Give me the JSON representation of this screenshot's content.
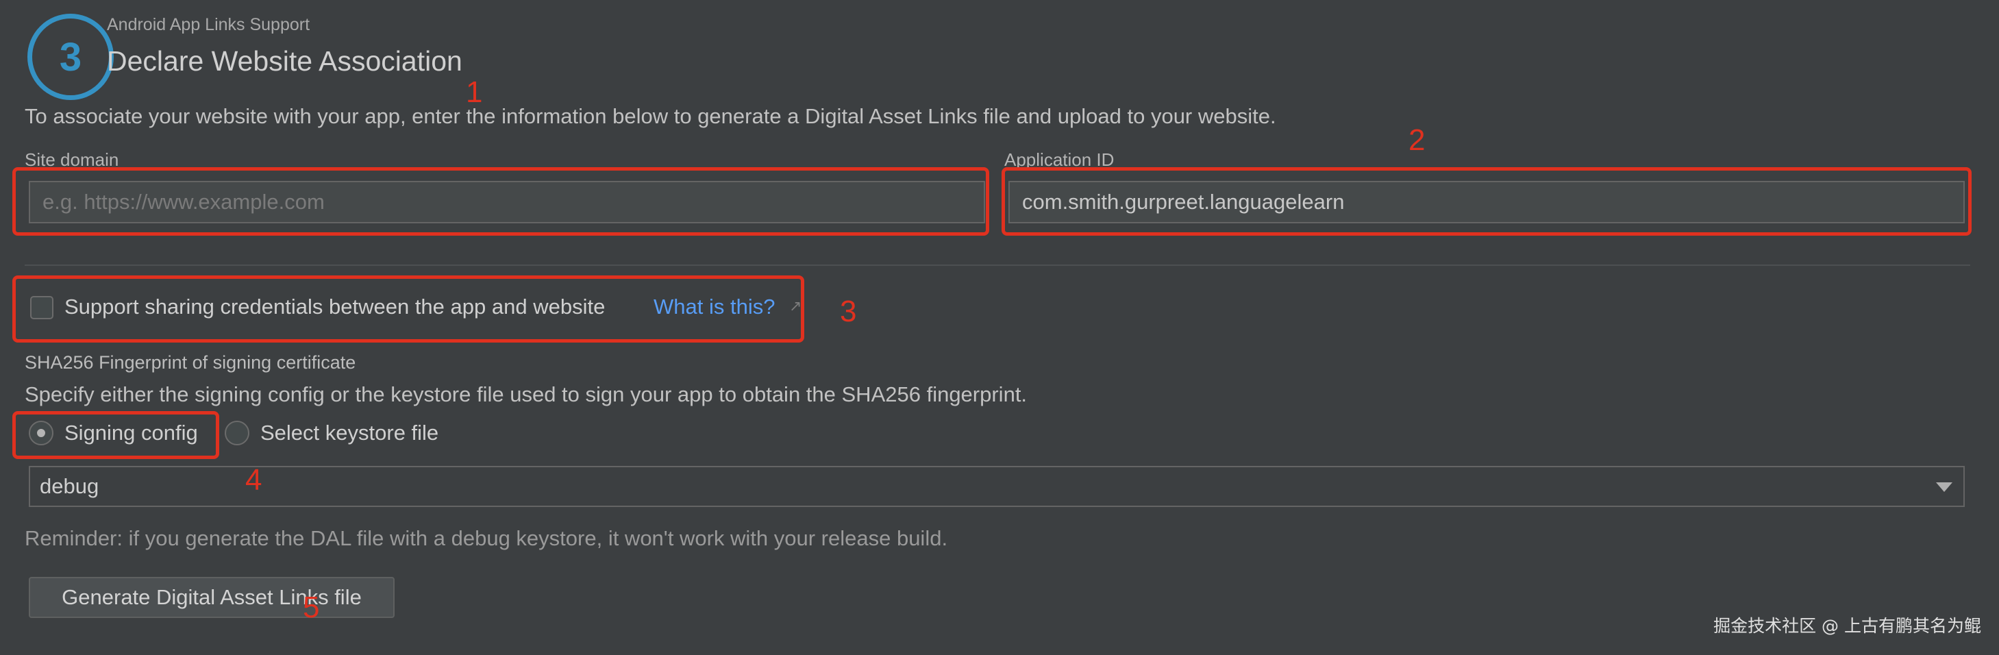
{
  "header": {
    "step_number": "3",
    "subtitle": "Android App Links Support",
    "title": "Declare Website Association"
  },
  "intro_text": "To associate your website with your app, enter the information below to generate a Digital Asset Links file and upload to your website.",
  "site_domain": {
    "label": "Site domain",
    "value": "",
    "placeholder": "e.g. https://www.example.com"
  },
  "application_id": {
    "label": "Application ID",
    "value": "com.smith.gurpreet.languagelearn"
  },
  "credentials": {
    "label": "Support sharing credentials between the app and website",
    "checked": false,
    "help_link": "What is this?",
    "link_arrow": "↗"
  },
  "sha256": {
    "heading": "SHA256 Fingerprint of signing certificate",
    "description": "Specify either the signing config or the keystore file used to sign your app to obtain the SHA256 fingerprint.",
    "options": [
      {
        "label": "Signing config",
        "selected": true
      },
      {
        "label": "Select keystore file",
        "selected": false
      }
    ],
    "signing_config": "debug"
  },
  "reminder": "Reminder: if you generate the DAL file with a debug keystore, it won't work with your release build.",
  "generate_button": "Generate Digital Asset Links file",
  "annotations": [
    "1",
    "2",
    "3",
    "4",
    "5"
  ],
  "watermark": "掘金技术社区 @ 上古有鹏其名为鲲",
  "colors": {
    "background": "#3c3f41",
    "accent": "#3592c4",
    "link": "#589df6",
    "annotation": "#e0311f"
  },
  "icons": [
    "step-badge",
    "external-link-arrow-icon",
    "dropdown-arrow-icon"
  ]
}
